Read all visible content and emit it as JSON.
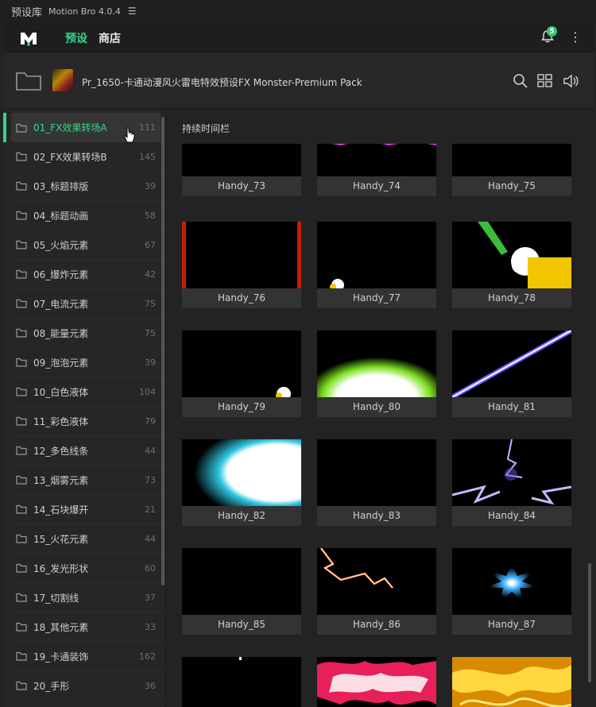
{
  "titlebar": {
    "app_name": "预设库",
    "version": "Motion Bro 4.0.4",
    "menu_icon": "hamburger-icon"
  },
  "nav": {
    "tab_presets": "预设",
    "tab_store": "商店",
    "notification_count": "5"
  },
  "pack": {
    "title": "Pr_1650-卡通动漫风火雷电特效预设FX Monster-Premium Pack"
  },
  "section_title": "持续时间栏",
  "categories": [
    {
      "name": "01_FX效果转场A",
      "count": "111"
    },
    {
      "name": "02_FX效果转场B",
      "count": "145"
    },
    {
      "name": "03_标题排版",
      "count": "39"
    },
    {
      "name": "04_标题动画",
      "count": "58"
    },
    {
      "name": "05_火焰元素",
      "count": "67"
    },
    {
      "name": "06_爆炸元素",
      "count": "42"
    },
    {
      "name": "07_电流元素",
      "count": "75"
    },
    {
      "name": "08_能量元素",
      "count": "75"
    },
    {
      "name": "09_泡泡元素",
      "count": "39"
    },
    {
      "name": "10_白色液体",
      "count": "104"
    },
    {
      "name": "11_彩色液体",
      "count": "79"
    },
    {
      "name": "12_多色线条",
      "count": "44"
    },
    {
      "name": "13_烟雾元素",
      "count": "73"
    },
    {
      "name": "14_石块爆开",
      "count": "21"
    },
    {
      "name": "15_火花元素",
      "count": "44"
    },
    {
      "name": "16_发光形状",
      "count": "60"
    },
    {
      "name": "17_切割线",
      "count": "37"
    },
    {
      "name": "18_其他元素",
      "count": "33"
    },
    {
      "name": "19_卡通装饰",
      "count": "162"
    },
    {
      "name": "20_手形",
      "count": "36"
    }
  ],
  "presets": [
    {
      "label": "Handy_73"
    },
    {
      "label": "Handy_74"
    },
    {
      "label": "Handy_75"
    },
    {
      "label": "Handy_76"
    },
    {
      "label": "Handy_77"
    },
    {
      "label": "Handy_78"
    },
    {
      "label": "Handy_79"
    },
    {
      "label": "Handy_80"
    },
    {
      "label": "Handy_81"
    },
    {
      "label": "Handy_82"
    },
    {
      "label": "Handy_83"
    },
    {
      "label": "Handy_84"
    },
    {
      "label": "Handy_85"
    },
    {
      "label": "Handy_86"
    },
    {
      "label": "Handy_87"
    },
    {
      "label": ""
    },
    {
      "label": ""
    },
    {
      "label": ""
    }
  ],
  "colors": {
    "accent": "#35d68a",
    "background": "#232323"
  }
}
